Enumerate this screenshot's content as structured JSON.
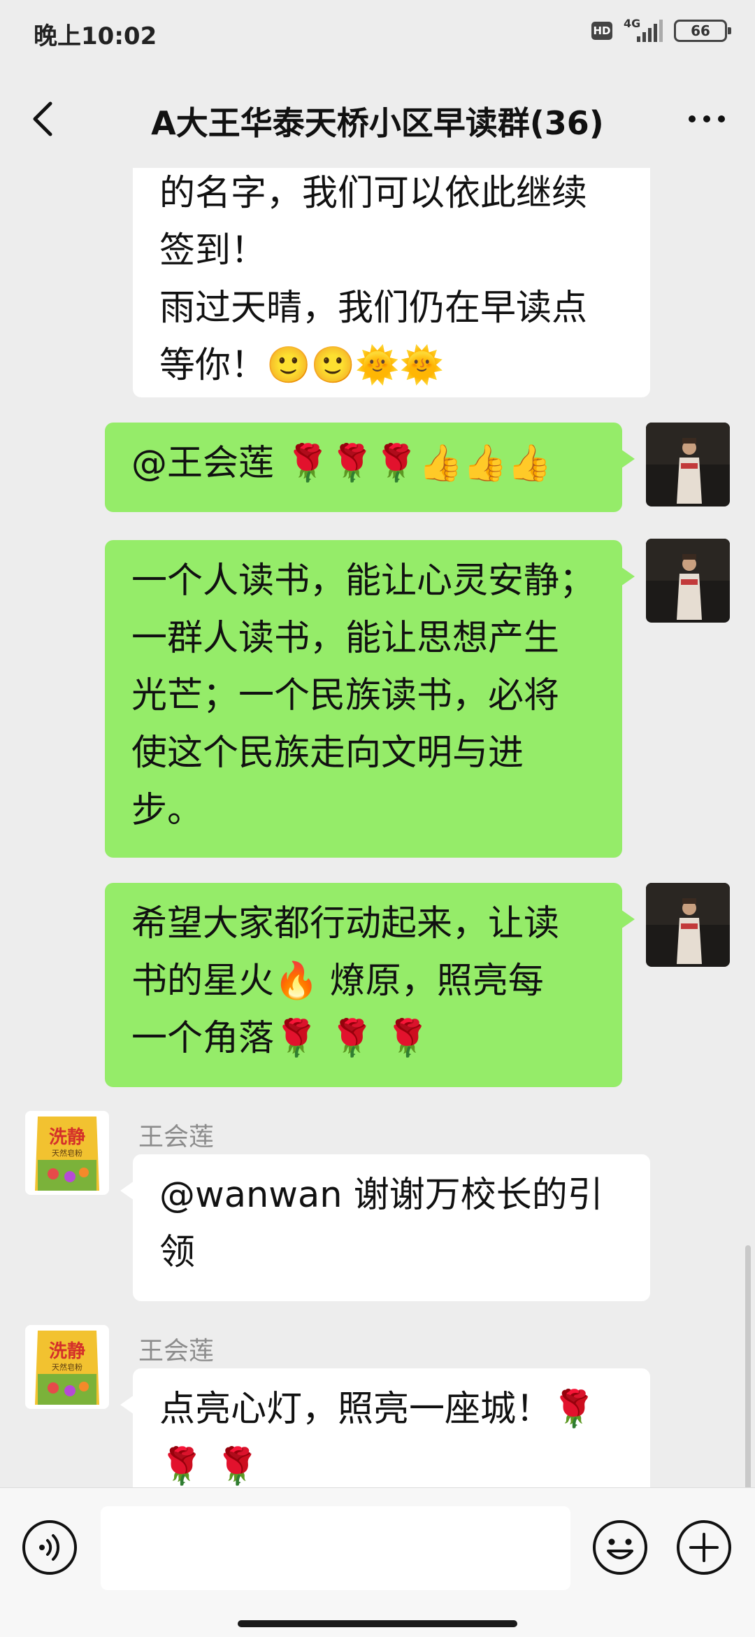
{
  "status_bar": {
    "time": "晚上10:02",
    "hd": "HD",
    "network": "4G",
    "battery": "66"
  },
  "header": {
    "title": "A大王华泰天桥小区早读群(36)"
  },
  "messages": [
    {
      "side": "left",
      "lines": [
        "的名字，我们可以依此继续",
        "签到！",
        "雨过天晴，我们仍在早读点",
        "等你！🙂🙂🌞🌞"
      ]
    },
    {
      "side": "right",
      "lines": [
        "@王会莲 🌹🌹🌹👍👍👍"
      ]
    },
    {
      "side": "right",
      "lines": [
        "一个人读书，能让心灵安静；",
        "一群人读书，能让思想产生",
        "光芒；一个民族读书，必将",
        "使这个民族走向文明与进",
        "步。"
      ]
    },
    {
      "side": "right",
      "lines": [
        "希望大家都行动起来，让读",
        "书的星火🔥 燎原，照亮每",
        "一个角落🌹 🌹 🌹"
      ]
    },
    {
      "side": "left",
      "sender": "王会莲",
      "lines": [
        "@wanwan 谢谢万校长的引",
        "领"
      ]
    },
    {
      "side": "left",
      "sender": "王会莲",
      "lines": [
        "点亮心灯，照亮一座城！🌹",
        "🌹 🌹"
      ]
    }
  ],
  "avatar_product": {
    "brand": "洗静",
    "sub": "天然皂粉"
  },
  "icons": {
    "back": "chevron-left-icon",
    "more": "more-dots-icon",
    "voice": "voice-icon",
    "emoji": "emoji-icon",
    "plus": "plus-icon"
  },
  "colors": {
    "self_bubble": "#95ec69",
    "other_bubble": "#ffffff",
    "background": "#ededed"
  }
}
